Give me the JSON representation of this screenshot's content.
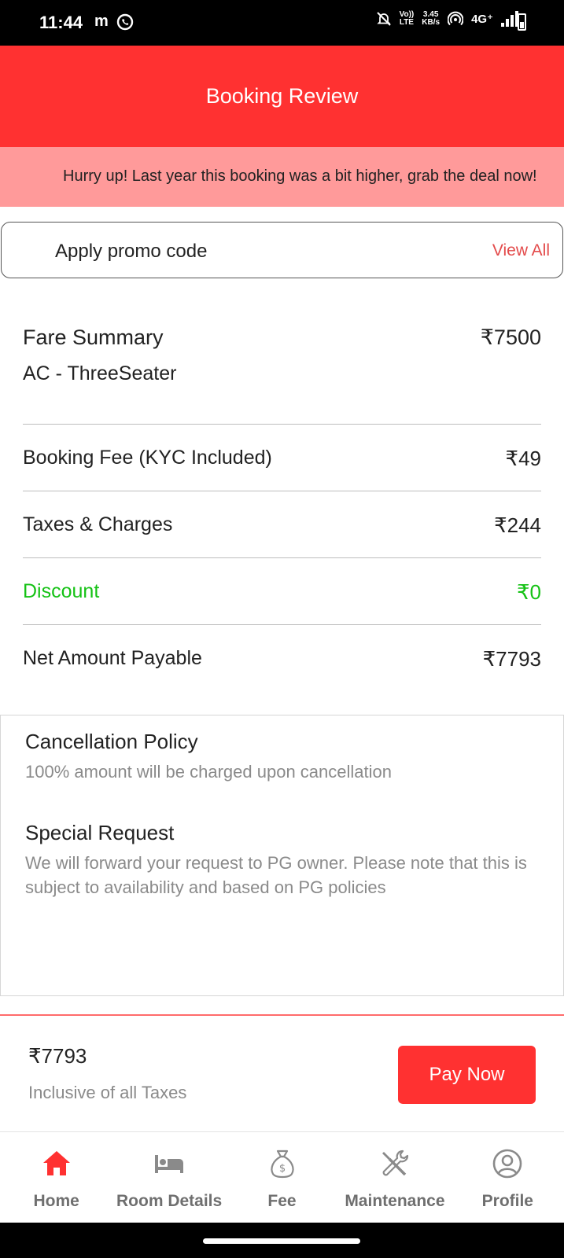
{
  "status_bar": {
    "time": "11:44",
    "app_icon_text": "m",
    "network": "4G⁺",
    "speed_value": "3.45",
    "speed_unit": "KB/s",
    "volte_top": "Vo))",
    "volte_bottom": "LTE"
  },
  "header": {
    "title": "Booking Review"
  },
  "banner": {
    "text": "Hurry up! Last year this booking was a bit higher, grab the deal now!"
  },
  "promo": {
    "label": "Apply promo code",
    "view_all": "View All"
  },
  "fare": {
    "title": "Fare Summary",
    "room_type": "AC - ThreeSeater",
    "amount": "₹7500",
    "rows": [
      {
        "label": "Booking Fee (KYC Included)",
        "value": "₹49"
      },
      {
        "label": "Taxes & Charges",
        "value": "₹244"
      },
      {
        "label": "Discount",
        "value": "₹0"
      },
      {
        "label": "Net Amount Payable",
        "value": "₹7793"
      }
    ]
  },
  "policy": {
    "cancellation_title": "Cancellation Policy",
    "cancellation_text": "100% amount will be charged upon cancellation",
    "special_title": "Special Request",
    "special_text": "We will forward your request to PG owner. Please note that this is subject to availability and based on PG policies"
  },
  "paybar": {
    "total": "₹7793",
    "note": "Inclusive of all Taxes",
    "pay_button": "Pay Now"
  },
  "bottom_nav": {
    "items": [
      {
        "label": "Home",
        "icon": "home-icon",
        "active": true
      },
      {
        "label": "Room Details",
        "icon": "bed-icon",
        "active": false
      },
      {
        "label": "Fee",
        "icon": "money-bag-icon",
        "active": false
      },
      {
        "label": "Maintenance",
        "icon": "tools-icon",
        "active": false
      },
      {
        "label": "Profile",
        "icon": "user-circle-icon",
        "active": false
      }
    ]
  },
  "colors": {
    "primary": "#ff3131",
    "banner": "#ff9a9a",
    "discount_green": "#15c215",
    "view_all": "#e34a4a",
    "nav_active": "#ff3131",
    "nav_inactive": "#6f6f6f"
  }
}
